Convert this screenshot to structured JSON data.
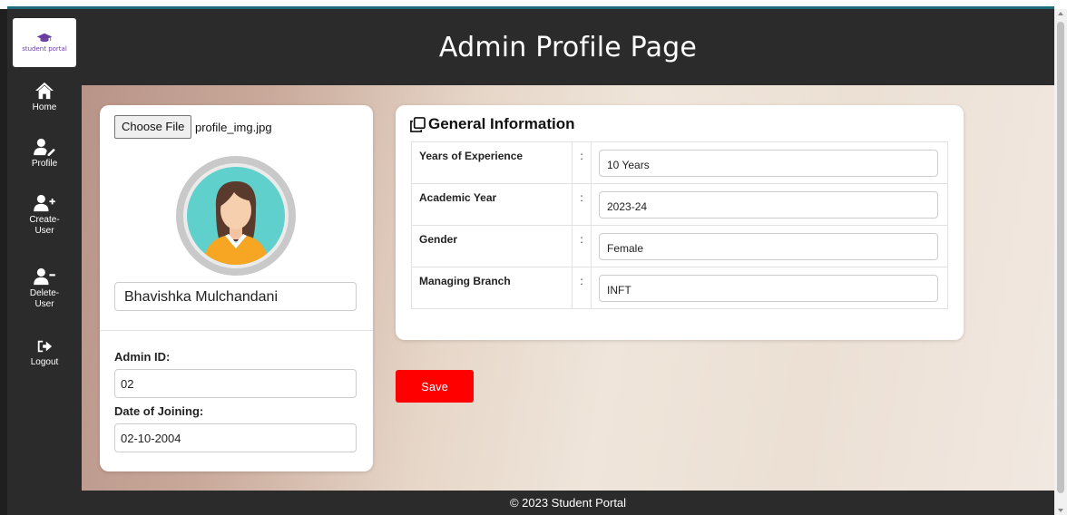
{
  "header": {
    "title": "Admin Profile Page"
  },
  "logo": {
    "text": "student portal",
    "icon": "graduation-cap-icon"
  },
  "sidebar": {
    "items": [
      {
        "label": "Home",
        "icon": "home-icon"
      },
      {
        "label": "Profile",
        "icon": "user-edit-icon"
      },
      {
        "label": "Create-\nUser",
        "icon": "user-plus-icon"
      },
      {
        "label": "Delete-\nUser",
        "icon": "user-minus-icon"
      },
      {
        "label": "Logout",
        "icon": "sign-out-icon"
      }
    ]
  },
  "profile_card": {
    "choose_file_label": "Choose File",
    "file_name": "profile_img.jpg",
    "name_value": "Bhavishka Mulchandani",
    "admin_id_label": "Admin ID:",
    "admin_id_value": "02",
    "doj_label": "Date of Joining:",
    "doj_value": "02-10-2004"
  },
  "general_info": {
    "title": "General Information",
    "rows": [
      {
        "label": "Years of Experience",
        "sep": ":",
        "value": "10 Years"
      },
      {
        "label": "Academic Year",
        "sep": ":",
        "value": "2023-24"
      },
      {
        "label": "Gender",
        "sep": ":",
        "value": "Female"
      },
      {
        "label": "Managing Branch",
        "sep": ":",
        "value": "INFT"
      }
    ]
  },
  "save_label": "Save",
  "footer": {
    "text": "© 2023 Student Portal"
  },
  "colors": {
    "accent": "#ff0000",
    "dark": "#2b2b2b",
    "logo": "#6b3fa0"
  }
}
